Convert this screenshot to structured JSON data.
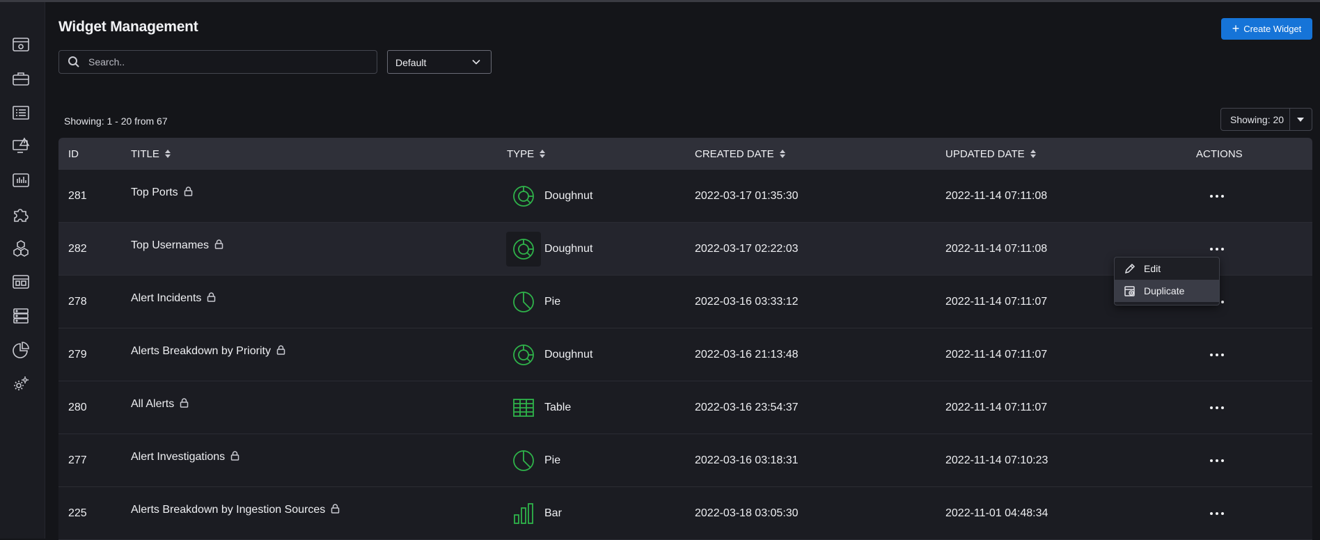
{
  "header": {
    "title": "Widget Management",
    "create_button": "Create Widget"
  },
  "search": {
    "placeholder": "Search.."
  },
  "filter": {
    "selected": "Default"
  },
  "pagination": {
    "summary": "Showing: 1 - 20 from 67",
    "page_size_label": "Showing: 20"
  },
  "table": {
    "headers": {
      "id": "ID",
      "title": "TITLE",
      "type": "TYPE",
      "created": "CREATED DATE",
      "updated": "UPDATED DATE",
      "actions": "ACTIONS"
    },
    "rows": [
      {
        "id": "281",
        "title": "Top Ports",
        "type": "Doughnut",
        "created": "2022-03-17 01:35:30",
        "updated": "2022-11-14 07:11:08"
      },
      {
        "id": "282",
        "title": "Top Usernames",
        "type": "Doughnut",
        "created": "2022-03-17 02:22:03",
        "updated": "2022-11-14 07:11:08"
      },
      {
        "id": "278",
        "title": "Alert Incidents",
        "type": "Pie",
        "created": "2022-03-16 03:33:12",
        "updated": "2022-11-14 07:11:07"
      },
      {
        "id": "279",
        "title": "Alerts Breakdown by Priority",
        "type": "Doughnut",
        "created": "2022-03-16 21:13:48",
        "updated": "2022-11-14 07:11:07"
      },
      {
        "id": "280",
        "title": "All Alerts",
        "type": "Table",
        "created": "2022-03-16 23:54:37",
        "updated": "2022-11-14 07:11:07"
      },
      {
        "id": "277",
        "title": "Alert Investigations",
        "type": "Pie",
        "created": "2022-03-16 03:18:31",
        "updated": "2022-11-14 07:10:23"
      },
      {
        "id": "225",
        "title": "Alerts Breakdown by Ingestion Sources",
        "type": "Bar",
        "created": "2022-03-18 03:05:30",
        "updated": "2022-11-01 04:48:34"
      }
    ]
  },
  "context_menu": {
    "edit": "Edit",
    "duplicate": "Duplicate"
  },
  "sidebar": {
    "icons": [
      "dashboard-icon",
      "briefcase-icon",
      "list-icon",
      "alert-monitor-icon",
      "bar-chart-icon",
      "puzzle-icon",
      "cubes-icon",
      "widget-panel-icon",
      "servers-icon",
      "pie-chart-icon",
      "settings-gears-icon"
    ]
  },
  "colors": {
    "accent": "#1674d8",
    "type_icon": "#2fb34a",
    "background": "#141519"
  }
}
